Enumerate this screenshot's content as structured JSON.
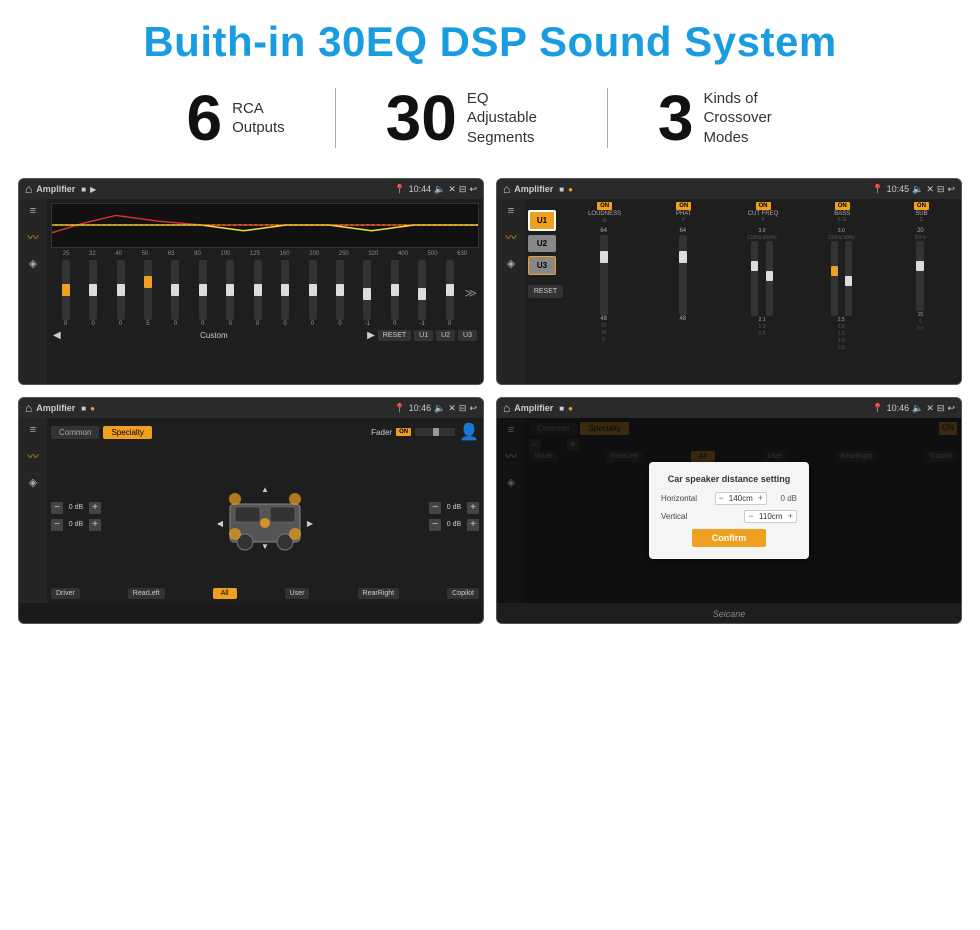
{
  "header": {
    "title": "Buith-in 30EQ DSP Sound System"
  },
  "stats": [
    {
      "number": "6",
      "label_line1": "RCA",
      "label_line2": "Outputs"
    },
    {
      "number": "30",
      "label_line1": "EQ Adjustable",
      "label_line2": "Segments"
    },
    {
      "number": "3",
      "label_line1": "Kinds of",
      "label_line2": "Crossover Modes"
    }
  ],
  "screen1": {
    "status_bar": {
      "title": "Amplifier",
      "time": "10:44"
    },
    "eq_labels": [
      "25",
      "32",
      "40",
      "50",
      "63",
      "80",
      "100",
      "125",
      "160",
      "200",
      "250",
      "320",
      "400",
      "500",
      "630"
    ],
    "eq_values": [
      "0",
      "0",
      "0",
      "5",
      "0",
      "0",
      "0",
      "0",
      "0",
      "0",
      "0",
      "-1",
      "0",
      "-1"
    ],
    "custom_label": "Custom",
    "buttons": [
      "RESET",
      "U1",
      "U2",
      "U3"
    ]
  },
  "screen2": {
    "status_bar": {
      "title": "Amplifier",
      "time": "10:45"
    },
    "u_buttons": [
      "U1",
      "U2",
      "U3"
    ],
    "controls": [
      {
        "label": "LOUDNESS",
        "on": true
      },
      {
        "label": "PHAT",
        "on": true
      },
      {
        "label": "CUT FREQ",
        "on": true
      },
      {
        "label": "BASS",
        "on": true
      },
      {
        "label": "SUB",
        "on": true
      }
    ],
    "reset_label": "RESET"
  },
  "screen3": {
    "status_bar": {
      "title": "Amplifier",
      "time": "10:46"
    },
    "tabs": [
      "Common",
      "Specialty"
    ],
    "active_tab": "Specialty",
    "fader_label": "Fader",
    "fader_on": true,
    "channels": [
      {
        "top_left": "0 dB",
        "top_right": "0 dB",
        "bot_left": "0 dB",
        "bot_right": "0 dB"
      }
    ],
    "buttons": [
      "Driver",
      "RearLeft",
      "All",
      "User",
      "RearRight",
      "Copilot"
    ]
  },
  "screen4": {
    "status_bar": {
      "title": "Amplifier",
      "time": "10:46"
    },
    "tabs": [
      "Common",
      "Specialty"
    ],
    "dialog": {
      "title": "Car speaker distance setting",
      "horizontal_label": "Horizontal",
      "horizontal_value": "140cm",
      "vertical_label": "Vertical",
      "vertical_value": "110cm",
      "right_label": "0 dB",
      "confirm_label": "Confirm"
    },
    "buttons": [
      "Driver",
      "RearLeft",
      "All",
      "User",
      "RearRight",
      "Copilot"
    ]
  },
  "seicane": "Seicane",
  "icons": {
    "home": "⌂",
    "back": "↩",
    "settings_sliders": "≡",
    "wave": "∿",
    "speaker": "◈",
    "expand": "≫"
  }
}
